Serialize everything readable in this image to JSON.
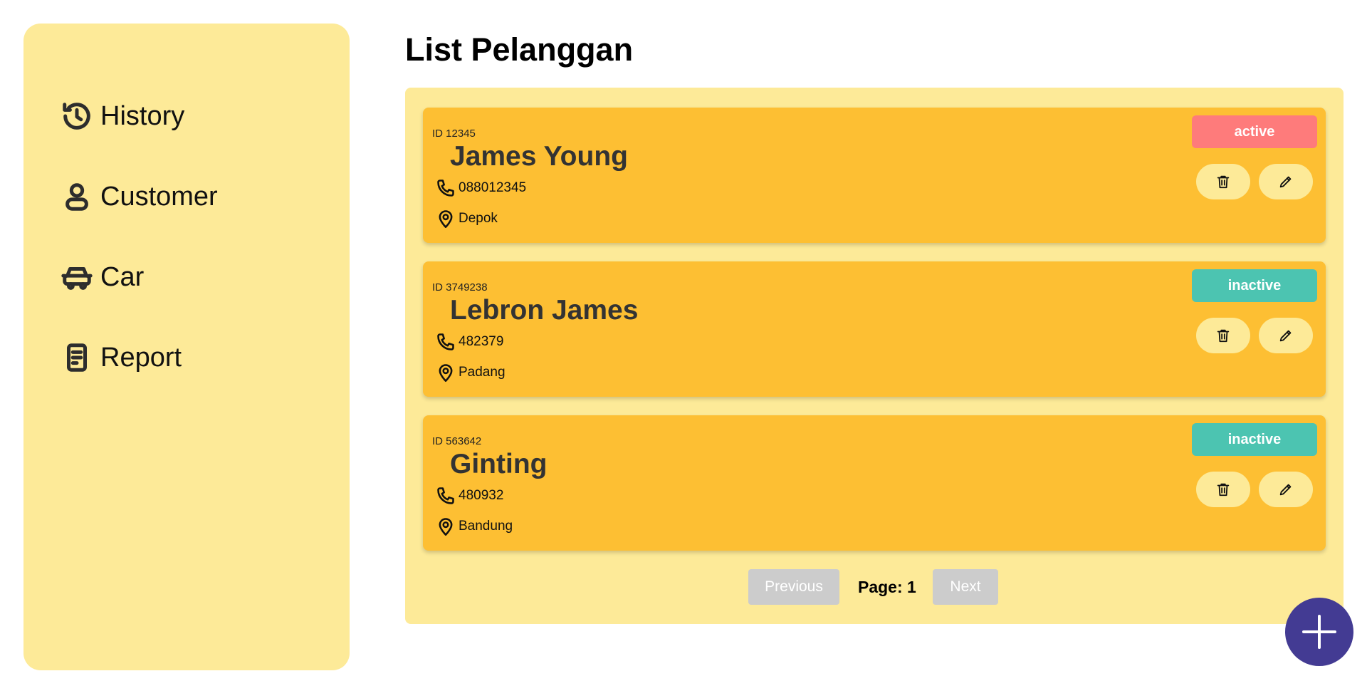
{
  "sidebar": {
    "items": [
      {
        "label": "History",
        "icon": "history-icon"
      },
      {
        "label": "Customer",
        "icon": "user-icon"
      },
      {
        "label": "Car",
        "icon": "car-icon"
      },
      {
        "label": "Report",
        "icon": "report-icon"
      }
    ]
  },
  "page": {
    "title": "List Pelanggan"
  },
  "customers": [
    {
      "id_label": "ID 12345",
      "name": "James Young",
      "phone": "088012345",
      "city": "Depok",
      "status": "active",
      "status_color": "#fe7b7b"
    },
    {
      "id_label": "ID 3749238",
      "name": "Lebron James",
      "phone": "482379",
      "city": "Padang",
      "status": "inactive",
      "status_color": "#4cc4b1"
    },
    {
      "id_label": "ID 563642",
      "name": "Ginting",
      "phone": "480932",
      "city": "Bandung",
      "status": "inactive",
      "status_color": "#4cc4b1"
    }
  ],
  "pagination": {
    "previous_label": "Previous",
    "page_label": "Page: 1",
    "next_label": "Next"
  },
  "colors": {
    "sidebar_bg": "#fdea98",
    "card_bg": "#fdbf33",
    "fab_bg": "#433b93",
    "pager_disabled": "#cccccc"
  },
  "fab": {
    "icon": "plus-icon"
  }
}
